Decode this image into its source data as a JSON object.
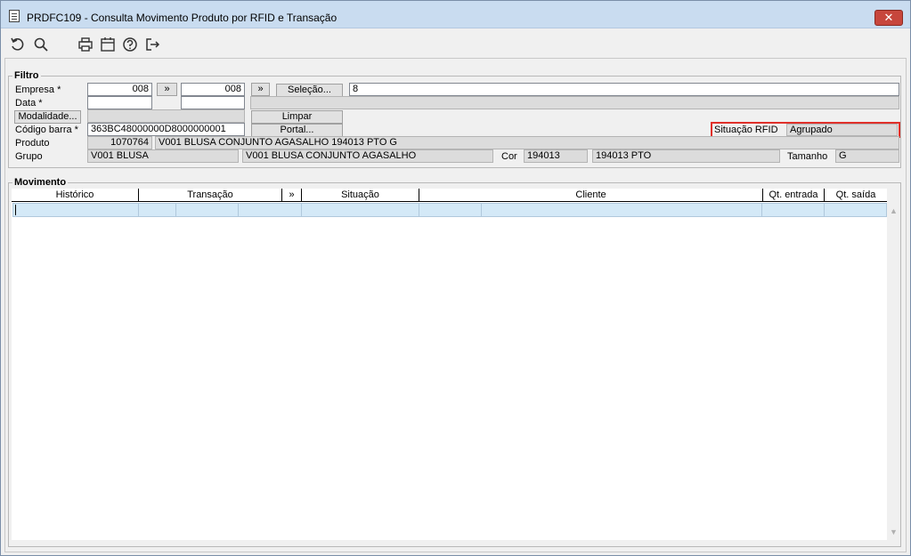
{
  "window": {
    "title": "PRDFC109 - Consulta Movimento Produto por RFID e Transação",
    "close_label": "✕"
  },
  "toolbar": {
    "icons": [
      "undo-icon",
      "search-icon",
      "print-icon",
      "calendar-icon",
      "help-icon",
      "exit-icon"
    ]
  },
  "filtro": {
    "legend": "Filtro",
    "empresa_label": "Empresa *",
    "empresa_from": "008",
    "empresa_to": "008",
    "range_button": "»",
    "range_button2": "»",
    "selecao_button": "Seleção...",
    "selecao_value": "8",
    "data_label": "Data *",
    "data_from": "",
    "data_to": "",
    "data_desc": "",
    "modalidade_button": "Modalidade...",
    "modalidade_value": "",
    "limpar_button": "Limpar",
    "codigo_barra_label": "Código barra *",
    "codigo_barra_value": "363BC48000000D8000000001",
    "portal_button": "Portal...",
    "situacao_rfid_label": "Situação RFID",
    "situacao_rfid_value": "Agrupado",
    "produto_label": "Produto",
    "produto_code": "1070764",
    "produto_desc": "V001 BLUSA CONJUNTO AGASALHO 194013 PTO G",
    "grupo_label": "Grupo",
    "grupo_code": "V001 BLUSA",
    "grupo_desc": "V001 BLUSA CONJUNTO AGASALHO",
    "cor_label": "Cor",
    "cor_code": "194013",
    "cor_desc": "194013 PTO",
    "tamanho_label": "Tamanho",
    "tamanho_value": "G"
  },
  "movimento": {
    "legend": "Movimento",
    "columns": {
      "historico": "Histórico",
      "transacao": "Transação",
      "expand": "»",
      "situacao": "Situação",
      "cliente": "Cliente",
      "qt_entrada": "Qt. entrada",
      "qt_saida": "Qt. saída"
    },
    "scroll_up": "▲",
    "scroll_down": "▼"
  }
}
